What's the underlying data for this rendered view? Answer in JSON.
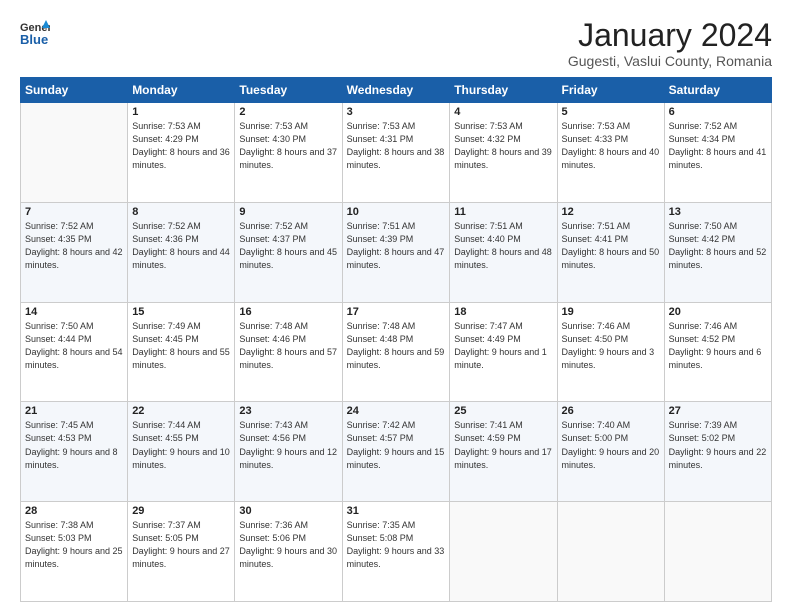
{
  "header": {
    "logo": {
      "general": "General",
      "blue": "Blue"
    },
    "title": "January 2024",
    "subtitle": "Gugesti, Vaslui County, Romania"
  },
  "weekdays": [
    "Sunday",
    "Monday",
    "Tuesday",
    "Wednesday",
    "Thursday",
    "Friday",
    "Saturday"
  ],
  "weeks": [
    [
      null,
      {
        "day": "1",
        "sunrise": "7:53 AM",
        "sunset": "4:29 PM",
        "daylight": "8 hours and 36 minutes."
      },
      {
        "day": "2",
        "sunrise": "7:53 AM",
        "sunset": "4:30 PM",
        "daylight": "8 hours and 37 minutes."
      },
      {
        "day": "3",
        "sunrise": "7:53 AM",
        "sunset": "4:31 PM",
        "daylight": "8 hours and 38 minutes."
      },
      {
        "day": "4",
        "sunrise": "7:53 AM",
        "sunset": "4:32 PM",
        "daylight": "8 hours and 39 minutes."
      },
      {
        "day": "5",
        "sunrise": "7:53 AM",
        "sunset": "4:33 PM",
        "daylight": "8 hours and 40 minutes."
      },
      {
        "day": "6",
        "sunrise": "7:52 AM",
        "sunset": "4:34 PM",
        "daylight": "8 hours and 41 minutes."
      }
    ],
    [
      {
        "day": "7",
        "sunrise": "7:52 AM",
        "sunset": "4:35 PM",
        "daylight": "8 hours and 42 minutes."
      },
      {
        "day": "8",
        "sunrise": "7:52 AM",
        "sunset": "4:36 PM",
        "daylight": "8 hours and 44 minutes."
      },
      {
        "day": "9",
        "sunrise": "7:52 AM",
        "sunset": "4:37 PM",
        "daylight": "8 hours and 45 minutes."
      },
      {
        "day": "10",
        "sunrise": "7:51 AM",
        "sunset": "4:39 PM",
        "daylight": "8 hours and 47 minutes."
      },
      {
        "day": "11",
        "sunrise": "7:51 AM",
        "sunset": "4:40 PM",
        "daylight": "8 hours and 48 minutes."
      },
      {
        "day": "12",
        "sunrise": "7:51 AM",
        "sunset": "4:41 PM",
        "daylight": "8 hours and 50 minutes."
      },
      {
        "day": "13",
        "sunrise": "7:50 AM",
        "sunset": "4:42 PM",
        "daylight": "8 hours and 52 minutes."
      }
    ],
    [
      {
        "day": "14",
        "sunrise": "7:50 AM",
        "sunset": "4:44 PM",
        "daylight": "8 hours and 54 minutes."
      },
      {
        "day": "15",
        "sunrise": "7:49 AM",
        "sunset": "4:45 PM",
        "daylight": "8 hours and 55 minutes."
      },
      {
        "day": "16",
        "sunrise": "7:48 AM",
        "sunset": "4:46 PM",
        "daylight": "8 hours and 57 minutes."
      },
      {
        "day": "17",
        "sunrise": "7:48 AM",
        "sunset": "4:48 PM",
        "daylight": "8 hours and 59 minutes."
      },
      {
        "day": "18",
        "sunrise": "7:47 AM",
        "sunset": "4:49 PM",
        "daylight": "9 hours and 1 minute."
      },
      {
        "day": "19",
        "sunrise": "7:46 AM",
        "sunset": "4:50 PM",
        "daylight": "9 hours and 3 minutes."
      },
      {
        "day": "20",
        "sunrise": "7:46 AM",
        "sunset": "4:52 PM",
        "daylight": "9 hours and 6 minutes."
      }
    ],
    [
      {
        "day": "21",
        "sunrise": "7:45 AM",
        "sunset": "4:53 PM",
        "daylight": "9 hours and 8 minutes."
      },
      {
        "day": "22",
        "sunrise": "7:44 AM",
        "sunset": "4:55 PM",
        "daylight": "9 hours and 10 minutes."
      },
      {
        "day": "23",
        "sunrise": "7:43 AM",
        "sunset": "4:56 PM",
        "daylight": "9 hours and 12 minutes."
      },
      {
        "day": "24",
        "sunrise": "7:42 AM",
        "sunset": "4:57 PM",
        "daylight": "9 hours and 15 minutes."
      },
      {
        "day": "25",
        "sunrise": "7:41 AM",
        "sunset": "4:59 PM",
        "daylight": "9 hours and 17 minutes."
      },
      {
        "day": "26",
        "sunrise": "7:40 AM",
        "sunset": "5:00 PM",
        "daylight": "9 hours and 20 minutes."
      },
      {
        "day": "27",
        "sunrise": "7:39 AM",
        "sunset": "5:02 PM",
        "daylight": "9 hours and 22 minutes."
      }
    ],
    [
      {
        "day": "28",
        "sunrise": "7:38 AM",
        "sunset": "5:03 PM",
        "daylight": "9 hours and 25 minutes."
      },
      {
        "day": "29",
        "sunrise": "7:37 AM",
        "sunset": "5:05 PM",
        "daylight": "9 hours and 27 minutes."
      },
      {
        "day": "30",
        "sunrise": "7:36 AM",
        "sunset": "5:06 PM",
        "daylight": "9 hours and 30 minutes."
      },
      {
        "day": "31",
        "sunrise": "7:35 AM",
        "sunset": "5:08 PM",
        "daylight": "9 hours and 33 minutes."
      },
      null,
      null,
      null
    ]
  ]
}
